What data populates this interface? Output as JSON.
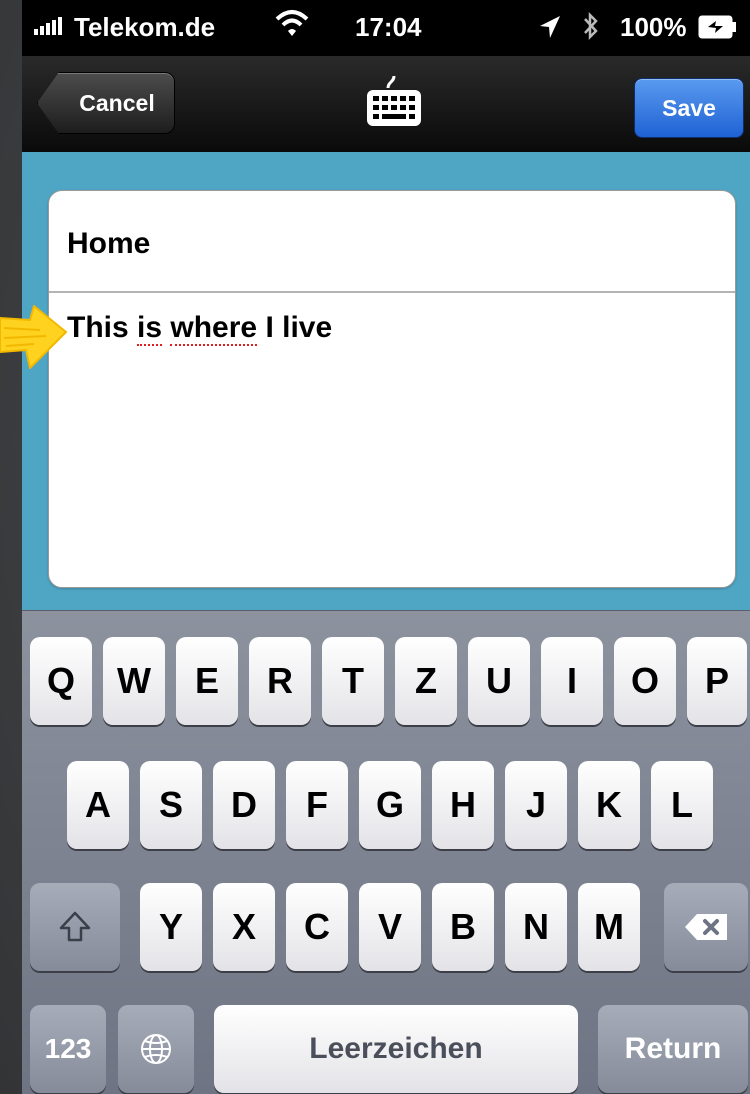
{
  "status_bar": {
    "carrier": "Telekom.de",
    "time": "17:04",
    "battery": "100%"
  },
  "nav_bar": {
    "back_label": "Cancel",
    "save_label": "Save",
    "center_icon": "keyboard-icon"
  },
  "note": {
    "title": "Home",
    "body_prefix": "This ",
    "body_word1": "is",
    "body_mid": " ",
    "body_word2": "where",
    "body_suffix": " I live"
  },
  "keyboard": {
    "row1": [
      "Q",
      "W",
      "E",
      "R",
      "T",
      "Z",
      "U",
      "I",
      "O",
      "P"
    ],
    "row2": [
      "A",
      "S",
      "D",
      "F",
      "G",
      "H",
      "J",
      "K",
      "L"
    ],
    "row3": [
      "Y",
      "X",
      "C",
      "V",
      "B",
      "N",
      "M"
    ],
    "numbers_label": "123",
    "space_label": "Leerzeichen",
    "return_label": "Return"
  },
  "colors": {
    "content_bg": "#4fa5c4",
    "save_button": "#2f74e0",
    "pointer": "#ffd21f"
  }
}
